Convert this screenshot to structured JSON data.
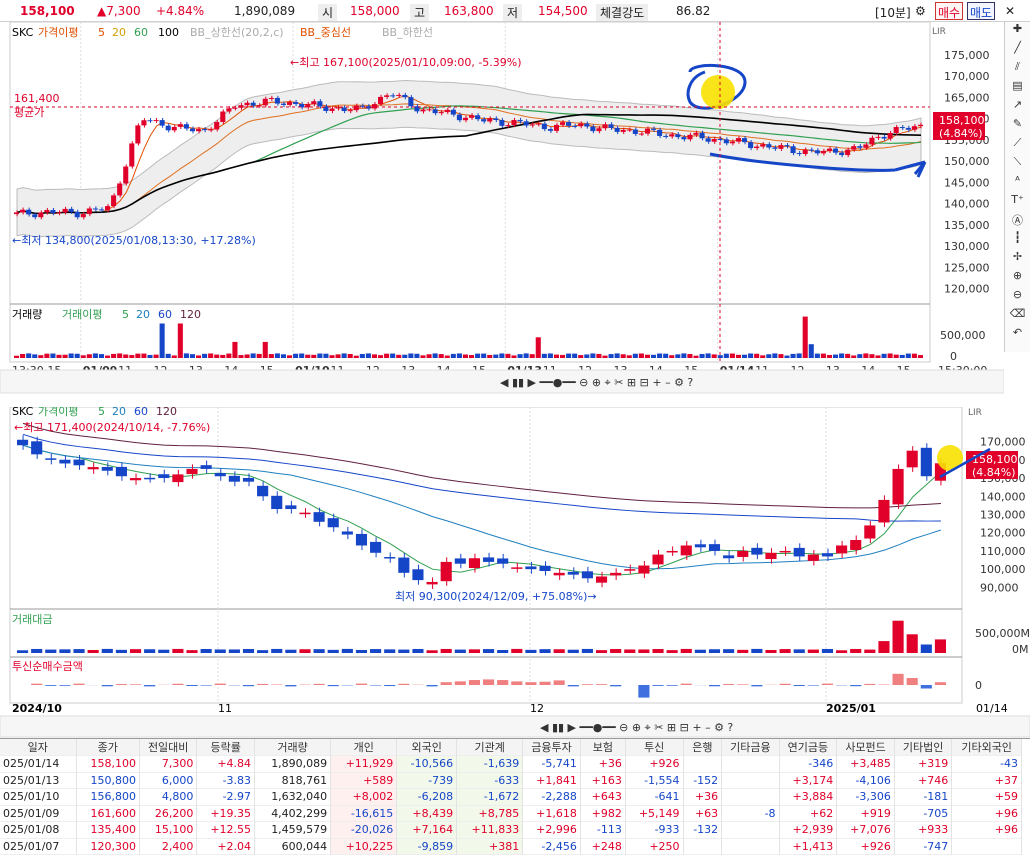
{
  "header": {
    "price": "158,100",
    "change": "▲7,300",
    "pct": "+4.84%",
    "volume": "1,890,089",
    "open_label": "시",
    "open": "158,000",
    "high_label": "고",
    "high": "163,800",
    "low_label": "저",
    "low": "154,500",
    "strength_label": "체결강도",
    "strength": "86.82",
    "interval": "[10분]",
    "buy": "매수",
    "sell": "매도"
  },
  "upper": {
    "legend": [
      "SKC",
      "가격이평",
      "5",
      "20",
      "60",
      "100",
      "BB_상한선(20,2,c)",
      "BB_중심선",
      "BB_하한선"
    ],
    "high_note": "←최고 167,100(2025/01/10,09:00, -5.39%)",
    "low_note": "←최저 134,800(2025/01/08,13:30, +17.28%)",
    "avg_value": "161,400",
    "avg_label": "평균가",
    "price_tag": "158,100",
    "price_tag_pct": "(4.84%)",
    "vol_legend": [
      "거래량",
      "거래이평",
      "5",
      "20",
      "60",
      "120"
    ],
    "vol_tick": "500,000",
    "vol_zero": "0",
    "time_end": "15:30:00",
    "scale": "LIR"
  },
  "lower": {
    "legend": [
      "SKC",
      "가격이평",
      "5",
      "20",
      "60",
      "120"
    ],
    "high_note": "←최고 171,400(2024/10/14, -7.76%)",
    "low_note": "최저 90,300(2024/12/09, +75.08%)→",
    "price_tag": "158,100",
    "price_tag_pct": "(4.84%)",
    "amount_label": "거래대금",
    "amount_tick": "500,000M",
    "amount_zero": "0M",
    "trust_label": "투신순매수금액",
    "trust_zero": "0",
    "x_start": "2024/10",
    "x_mid1": "11",
    "x_mid2": "12",
    "x_mid3": "2025/01",
    "x_end": "01/14",
    "scale": "LIR"
  },
  "chart_data": [
    {
      "type": "candlestick",
      "title": "SKC 10분",
      "interval": "10분",
      "ylim": [
        118000,
        178000
      ],
      "y_ticks": [
        120000,
        125000,
        130000,
        135000,
        140000,
        145000,
        150000,
        155000,
        160000,
        165000,
        170000,
        175000
      ],
      "x_ticks": [
        "13:30",
        "15",
        "01/09",
        "11",
        "12",
        "13",
        "14",
        "15",
        "01/10",
        "11",
        "12",
        "13",
        "14",
        "15",
        "01/13",
        "11",
        "12",
        "13",
        "14",
        "15",
        "01/14",
        "11",
        "12",
        "13",
        "14",
        "15"
      ],
      "series": [
        {
          "name": "가격이평 5"
        },
        {
          "name": "20"
        },
        {
          "name": "60"
        },
        {
          "name": "100"
        },
        {
          "name": "BB_상한선(20,2,c)"
        },
        {
          "name": "BB_중심선"
        },
        {
          "name": "BB_하한선"
        }
      ],
      "close_approx": [
        137500,
        138000,
        137800,
        139000,
        160000,
        158000,
        157000,
        163000,
        164000,
        163500,
        162500,
        162000,
        166000,
        162000,
        161000,
        159500,
        159000,
        158000,
        158500,
        157500,
        157000,
        156000,
        155500,
        154500,
        153500,
        152500,
        152000,
        153000,
        157000,
        158100
      ],
      "high": 167100,
      "low": 134800,
      "last": 158100,
      "avg": 161400
    },
    {
      "type": "candlestick",
      "title": "SKC 일",
      "interval": "일",
      "ylim": [
        82000,
        178000
      ],
      "y_ticks": [
        90000,
        100000,
        110000,
        120000,
        130000,
        140000,
        150000,
        160000,
        170000
      ],
      "x_ticks": [
        "2024/10",
        "11",
        "12",
        "2025/01",
        "01/14"
      ],
      "series": [
        {
          "name": "가격이평 5"
        },
        {
          "name": "20"
        },
        {
          "name": "60"
        },
        {
          "name": "120"
        }
      ],
      "close_approx": [
        168000,
        163000,
        160000,
        158000,
        157000,
        156000,
        154000,
        151000,
        150000,
        150000,
        150000,
        152000,
        155000,
        155000,
        151000,
        148000,
        148000,
        140000,
        133000,
        133000,
        131000,
        126000,
        123000,
        119000,
        113000,
        109000,
        106000,
        98000,
        94000,
        93000,
        104000,
        103000,
        106000,
        104000,
        103000,
        101000,
        100000,
        99000,
        98000,
        97000,
        95000,
        96000,
        98000,
        100000,
        102000,
        108000,
        110000,
        113000,
        112000,
        110000,
        106000,
        110000,
        108000,
        109000,
        110000,
        107000,
        108000,
        107000,
        113000,
        116000,
        124000,
        138000,
        155000,
        165000,
        151000,
        158100
      ],
      "high": 171400,
      "low": 90300,
      "last": 158100
    }
  ],
  "table": {
    "headers": [
      "일자",
      "종가",
      "전일대비",
      "등락률",
      "거래량",
      "개인",
      "외국인",
      "기관계",
      "금융투자",
      "보험",
      "투신",
      "은행",
      "기타금융",
      "연기금등",
      "사모펀드",
      "기타법인",
      "기타외국인"
    ],
    "rows": [
      [
        "025/01/14",
        "158,100",
        "7,300",
        "+4.84",
        "1,890,089",
        "+11,929",
        "-10,566",
        "-1,639",
        "-5,741",
        "+36",
        "+926",
        "",
        "",
        "-346",
        "+3,485",
        "+319",
        "-43"
      ],
      [
        "025/01/13",
        "150,800",
        "6,000",
        "-3.83",
        "818,761",
        "+589",
        "-739",
        "-633",
        "+1,841",
        "+163",
        "-1,554",
        "-152",
        "",
        "+3,174",
        "-4,106",
        "+746",
        "+37"
      ],
      [
        "025/01/10",
        "156,800",
        "4,800",
        "-2.97",
        "1,632,040",
        "+8,002",
        "-6,208",
        "-1,672",
        "-2,288",
        "+643",
        "-641",
        "+36",
        "",
        "+3,884",
        "-3,306",
        "-181",
        "+59"
      ],
      [
        "025/01/09",
        "161,600",
        "26,200",
        "+19.35",
        "4,402,299",
        "-16,615",
        "+8,439",
        "+8,785",
        "+1,618",
        "+982",
        "+5,149",
        "+63",
        "-8",
        "+62",
        "+919",
        "-705",
        "+96"
      ],
      [
        "025/01/08",
        "135,400",
        "15,100",
        "+12.55",
        "1,459,579",
        "-20,026",
        "+7,164",
        "+11,833",
        "+2,996",
        "-113",
        "-933",
        "-132",
        "",
        "+2,939",
        "+7,076",
        "+933",
        "+96"
      ],
      [
        "025/01/07",
        "120,300",
        "2,400",
        "+2.04",
        "600,044",
        "+10,225",
        "-9,859",
        "+381",
        "-2,456",
        "+248",
        "+250",
        "",
        "",
        "+1,413",
        "+926",
        "-747",
        ""
      ]
    ]
  },
  "colors": {
    "up": "#e0002a",
    "down": "#1646c8",
    "ma5": "#e05000",
    "ma20": "#f0c000",
    "ma60": "#30a050",
    "ma100": "#000000",
    "bb": "#bbbbbb"
  }
}
